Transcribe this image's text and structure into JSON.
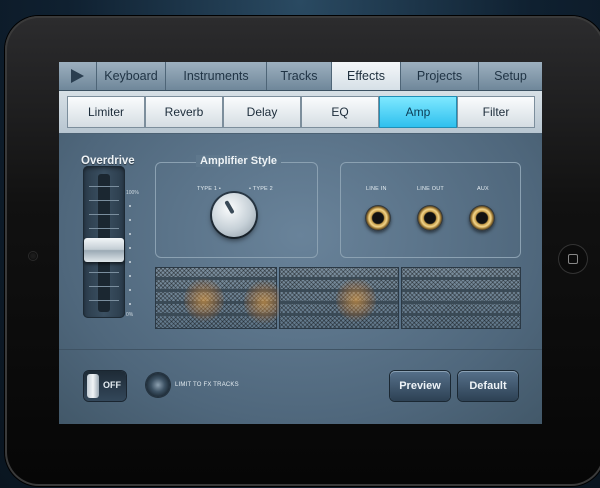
{
  "tabs": [
    {
      "label": "Keyboard"
    },
    {
      "label": "Instruments"
    },
    {
      "label": "Tracks"
    },
    {
      "label": "Effects",
      "active": true
    },
    {
      "label": "Projects"
    },
    {
      "label": "Setup"
    }
  ],
  "effects": [
    {
      "label": "Limiter"
    },
    {
      "label": "Reverb"
    },
    {
      "label": "Delay"
    },
    {
      "label": "EQ"
    },
    {
      "label": "Amp",
      "active": true
    },
    {
      "label": "Filter"
    }
  ],
  "overdrive": {
    "title": "Overdrive",
    "max_label": "100%",
    "min_label": "0%",
    "level": 0.45
  },
  "amp_style": {
    "title": "Amplifier Style",
    "type1": "TYPE 1",
    "type2": "TYPE 2"
  },
  "jacks": {
    "line_in": "LINE IN",
    "line_out": "LINE OUT",
    "aux": "AUX"
  },
  "footer": {
    "toggle_label": "OFF",
    "limit_label": "LIMIT TO FX TRACKS",
    "preview_label": "Preview",
    "default_label": "Default"
  },
  "colors": {
    "accent": "#2fc0ee",
    "panel": "#5a7186"
  },
  "icons": {
    "play": "play-icon",
    "home": "home-button"
  }
}
